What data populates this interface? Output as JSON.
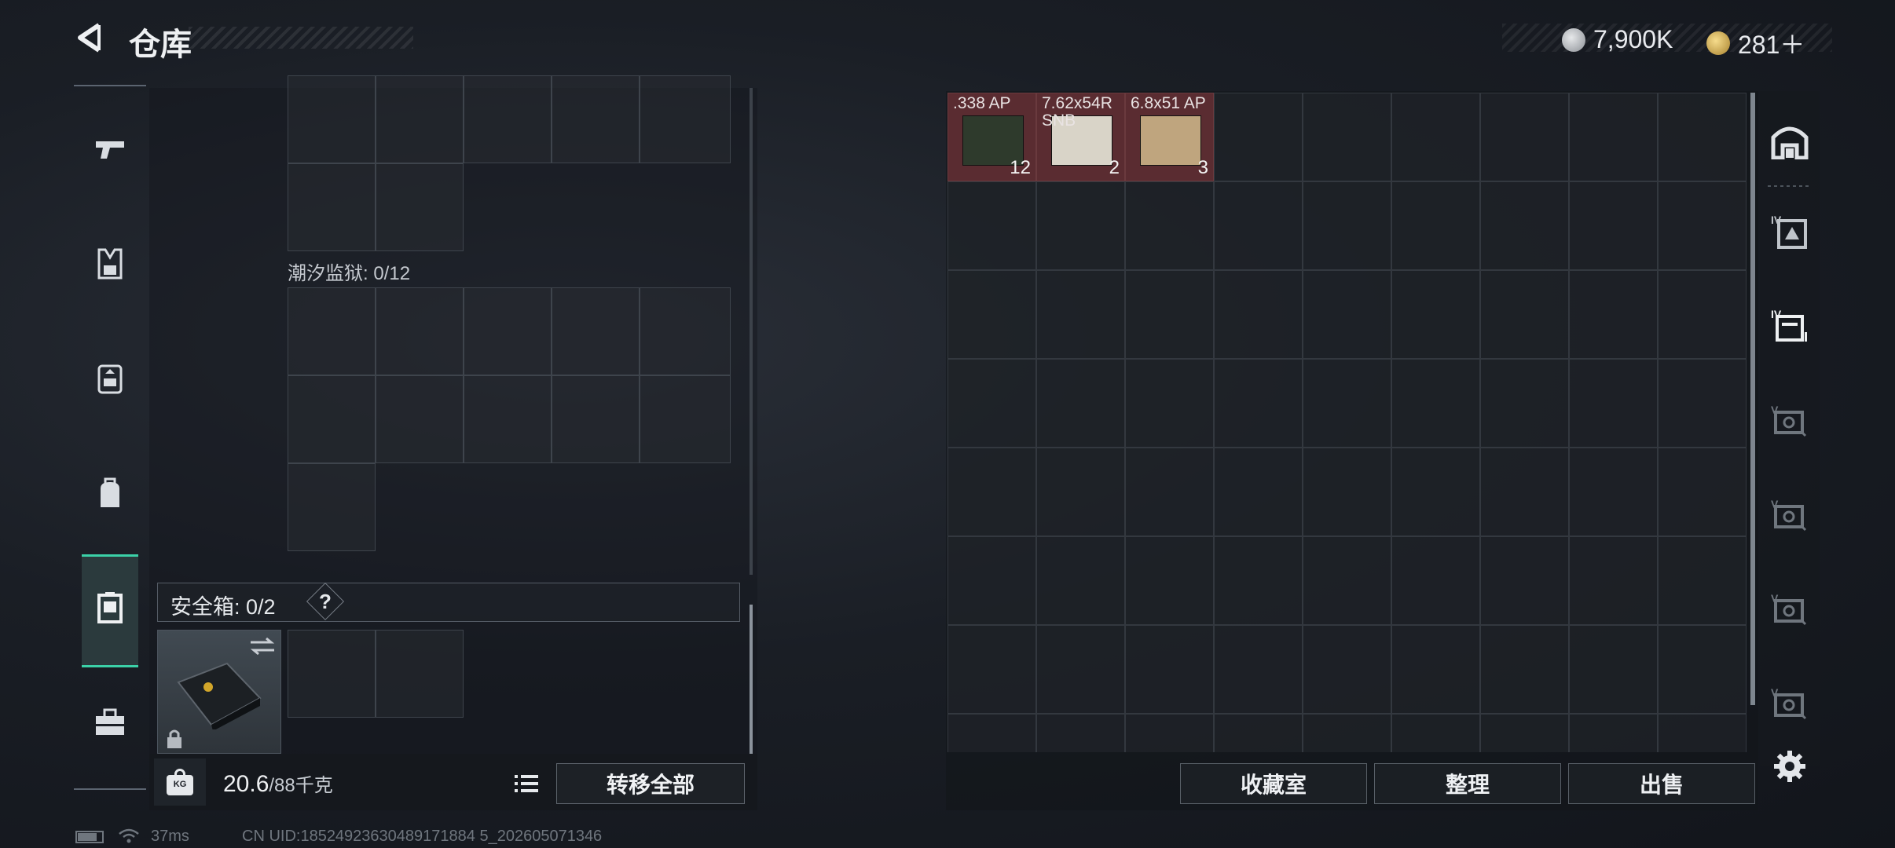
{
  "header": {
    "title": "仓库",
    "currency_silver": "7,900K",
    "currency_gold": "281＋"
  },
  "left_panel": {
    "grid_label": "潮汐监狱: 0/12",
    "safe_box_label": "安全箱: 0/2",
    "help_mark": "?",
    "weight_current": "20.6",
    "weight_max": "/88千克",
    "weight_icon_text": "KG",
    "transfer_all_label": "转移全部"
  },
  "stash": {
    "items": [
      {
        "name": ".338 AP",
        "count": "12"
      },
      {
        "name": "7.62x54R SNB",
        "count": "2"
      },
      {
        "name": "6.8x51 AP",
        "count": "3"
      }
    ],
    "buttons": {
      "collection": "收藏室",
      "organize": "整理",
      "sell": "出售"
    }
  },
  "status_bar": {
    "ping": "37ms",
    "uid": "CN UID:18524923630489171884 5_202605071346"
  },
  "colors": {
    "accent": "#3bd1a8",
    "item_bg": "#5a2c31"
  }
}
